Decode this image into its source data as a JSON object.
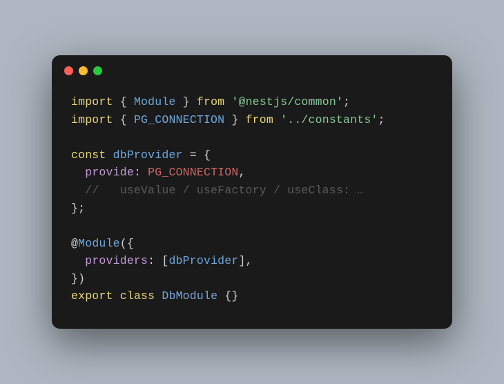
{
  "code": {
    "lines": [
      {
        "tokens": [
          {
            "t": "import",
            "c": "kw"
          },
          {
            "t": " { ",
            "c": "punct"
          },
          {
            "t": "Module",
            "c": "ident"
          },
          {
            "t": " } ",
            "c": "punct"
          },
          {
            "t": "from",
            "c": "kw"
          },
          {
            "t": " ",
            "c": "punct"
          },
          {
            "t": "'@nestjs/common'",
            "c": "str"
          },
          {
            "t": ";",
            "c": "punct"
          }
        ]
      },
      {
        "tokens": [
          {
            "t": "import",
            "c": "kw"
          },
          {
            "t": " { ",
            "c": "punct"
          },
          {
            "t": "PG_CONNECTION",
            "c": "ident"
          },
          {
            "t": " } ",
            "c": "punct"
          },
          {
            "t": "from",
            "c": "kw"
          },
          {
            "t": " ",
            "c": "punct"
          },
          {
            "t": "'../constants'",
            "c": "str"
          },
          {
            "t": ";",
            "c": "punct"
          }
        ]
      },
      {
        "tokens": [
          {
            "t": "",
            "c": "punct"
          }
        ]
      },
      {
        "tokens": [
          {
            "t": "const",
            "c": "kw"
          },
          {
            "t": " ",
            "c": "punct"
          },
          {
            "t": "dbProvider",
            "c": "ident"
          },
          {
            "t": " = {",
            "c": "punct"
          }
        ]
      },
      {
        "tokens": [
          {
            "t": "  ",
            "c": "punct"
          },
          {
            "t": "provide",
            "c": "prop"
          },
          {
            "t": ": ",
            "c": "punct"
          },
          {
            "t": "PG_CONNECTION",
            "c": "const-name"
          },
          {
            "t": ",",
            "c": "punct"
          }
        ]
      },
      {
        "tokens": [
          {
            "t": "  ",
            "c": "punct"
          },
          {
            "t": "//   useValue / useFactory / useClass: …",
            "c": "comment"
          }
        ]
      },
      {
        "tokens": [
          {
            "t": "};",
            "c": "punct"
          }
        ]
      },
      {
        "tokens": [
          {
            "t": "",
            "c": "punct"
          }
        ]
      },
      {
        "tokens": [
          {
            "t": "@",
            "c": "punct"
          },
          {
            "t": "Module",
            "c": "ident"
          },
          {
            "t": "({",
            "c": "punct"
          }
        ]
      },
      {
        "tokens": [
          {
            "t": "  ",
            "c": "punct"
          },
          {
            "t": "providers",
            "c": "prop"
          },
          {
            "t": ": [",
            "c": "punct"
          },
          {
            "t": "dbProvider",
            "c": "ident"
          },
          {
            "t": "],",
            "c": "punct"
          }
        ]
      },
      {
        "tokens": [
          {
            "t": "})",
            "c": "punct"
          }
        ]
      },
      {
        "tokens": [
          {
            "t": "export",
            "c": "kw"
          },
          {
            "t": " ",
            "c": "punct"
          },
          {
            "t": "class",
            "c": "kw"
          },
          {
            "t": " ",
            "c": "punct"
          },
          {
            "t": "DbModule",
            "c": "class-name"
          },
          {
            "t": " {}",
            "c": "punct"
          }
        ]
      }
    ]
  }
}
